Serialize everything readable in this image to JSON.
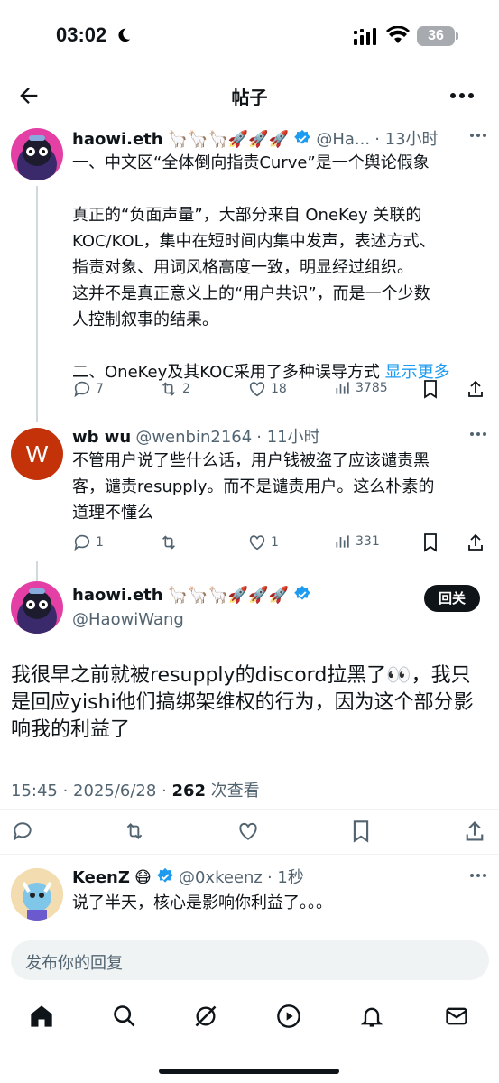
{
  "status": {
    "time": "03:02",
    "battery": "36"
  },
  "header": {
    "title": "帖子"
  },
  "tweet1": {
    "name": "haowi.eth",
    "emojis": "🦙🦙🦙🚀🚀🚀",
    "handle": "@Ha...",
    "time": "· 13小时",
    "lines": [
      "一、中文区“全体倒向指责Curve”是一个舆论假象",
      "",
      "真正的“负面声量”，大部分来自 OneKey 关联的",
      "KOC/KOL，集中在短时间内集中发声，表述方式、",
      "指责对象、用词风格高度一致，明显经过组织。",
      "这并不是真正意义上的“用户共识”，而是一个少数",
      "人控制叙事的结果。",
      "",
      "二、OneKey及其KOC采用了多种误导方式"
    ],
    "show_more": "显示更多",
    "replies": "7",
    "retweets": "2",
    "likes": "18",
    "views": "3785"
  },
  "tweet2": {
    "avatar_letter": "W",
    "name": "wb wu",
    "handle": "@wenbin2164",
    "time": "· 11小时",
    "lines": [
      "不管用户说了些什么话，用户钱被盗了应该谴责黑",
      "客，谴责resupply。而不是谴责用户。这么朴素的",
      "道理不懂么"
    ],
    "replies": "1",
    "likes": "1",
    "views": "331"
  },
  "main": {
    "name": "haowi.eth",
    "emojis": "🦙🦙🦙🚀🚀🚀",
    "handle": "@HaowiWang",
    "follow_label": "回关",
    "text": "我很早之前就被resupply的discord拉黑了👀，我只是回应yishi他们搞绑架维权的行为，因为这个部分影响我的利益了",
    "date": "15:45 · 2025/6/28 · ",
    "views_count": "262",
    "views_label": " 次查看"
  },
  "reply3": {
    "name": "KeenZ",
    "emoji": "😷",
    "handle": "@0xkeenz",
    "time": "· 1秒",
    "text": "说了半天，核心是影响你利益了。。。"
  },
  "reply_bar": {
    "placeholder": "发布你的回复"
  },
  "colors": {
    "accent": "#1d9bf0",
    "muted": "#536471",
    "avatar_w": "#c4320a"
  }
}
